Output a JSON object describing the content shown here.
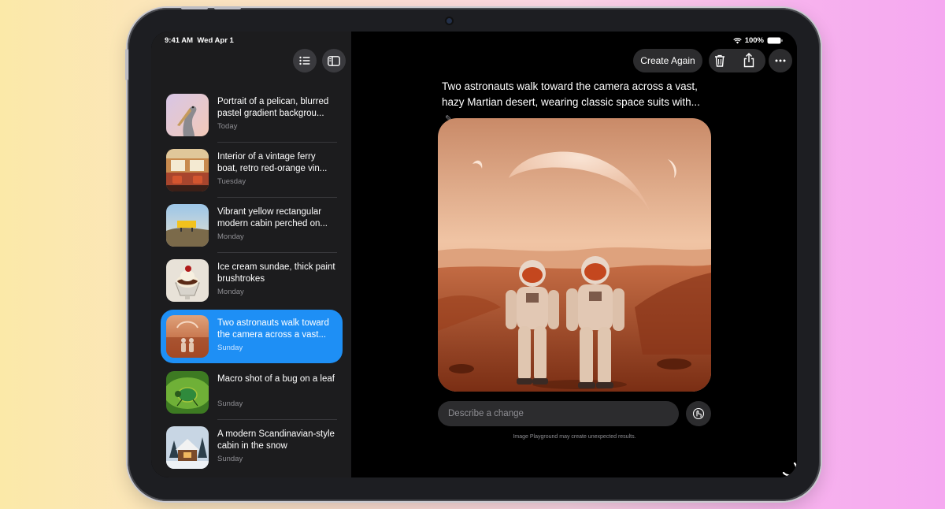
{
  "status_bar": {
    "time": "9:41 AM",
    "date": "Wed Apr 1",
    "battery": "100%"
  },
  "sidebar": {
    "toolbar": [
      "list-icon",
      "sidebar-icon",
      "plus-icon"
    ],
    "items": [
      {
        "title": "Portrait of a pelican, blurred pastel gradient backgrou...",
        "date": "Today",
        "thumb": "pelican",
        "selected": false
      },
      {
        "title": "Interior of a vintage ferry boat, retro red-orange vin...",
        "date": "Tuesday",
        "thumb": "ferry",
        "selected": false
      },
      {
        "title": "Vibrant yellow rectangular modern cabin perched on...",
        "date": "Monday",
        "thumb": "cabin-yellow",
        "selected": false
      },
      {
        "title": "Ice cream sundae, thick paint brushtrokes",
        "date": "Monday",
        "thumb": "sundae",
        "selected": false
      },
      {
        "title": "Two astronauts walk toward the camera across a vast...",
        "date": "Sunday",
        "thumb": "astronauts",
        "selected": true
      },
      {
        "title": "Macro shot of a bug on a leaf",
        "date": "Sunday",
        "thumb": "bug",
        "selected": false
      },
      {
        "title": "A modern Scandinavian-style cabin in the snow",
        "date": "Sunday",
        "thumb": "snow-cabin",
        "selected": false
      }
    ]
  },
  "main": {
    "create_again": "Create Again",
    "prompt": "Two astronauts walk toward the camera across a vast, hazy Martian desert, wearing classic space suits with...",
    "describe_placeholder": "Describe a change",
    "disclaimer": "Image Playground may create unexpected results."
  },
  "colors": {
    "accent": "#1e8ff5",
    "sidebar_bg": "#1c1c1e",
    "control_bg": "#2c2c2e"
  }
}
